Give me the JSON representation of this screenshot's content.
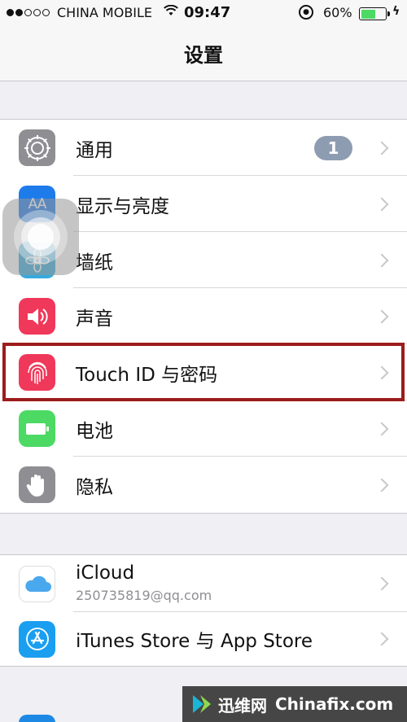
{
  "status_bar": {
    "carrier": "CHINA MOBILE",
    "time": "09:47",
    "battery_percent": "60%",
    "battery_level": 0.6,
    "signal_bars_filled": 2,
    "signal_bars_total": 5
  },
  "nav": {
    "title": "设置"
  },
  "groups": [
    {
      "items": [
        {
          "label": "通用",
          "icon": "gear-icon",
          "color": "#8e8e93",
          "badge": "1"
        },
        {
          "label": "显示与亮度",
          "icon": "text-size-icon",
          "color": "#1e7bea"
        },
        {
          "label": "墙纸",
          "icon": "wallpaper-flower-icon",
          "color": "#37aadc"
        },
        {
          "label": "声音",
          "icon": "speaker-icon",
          "color": "#f0385a"
        },
        {
          "label": "Touch ID 与密码",
          "icon": "fingerprint-icon",
          "color": "#f0385a"
        },
        {
          "label": "电池",
          "icon": "battery-icon",
          "color": "#4cd964"
        },
        {
          "label": "隐私",
          "icon": "hand-icon",
          "color": "#8e8e93"
        }
      ]
    },
    {
      "items": [
        {
          "label": "iCloud",
          "sublabel": "250735819@qq.com",
          "icon": "cloud-icon",
          "color": "#ffffff"
        },
        {
          "label": "iTunes Store 与 App Store",
          "icon": "app-store-icon",
          "color": "#1a9ff0"
        }
      ]
    }
  ],
  "watermark": {
    "cn": "迅维网",
    "en": "Chinafix.com"
  },
  "colors": {
    "highlight": "#9d1b1b",
    "badge": "#8e9cb1"
  }
}
